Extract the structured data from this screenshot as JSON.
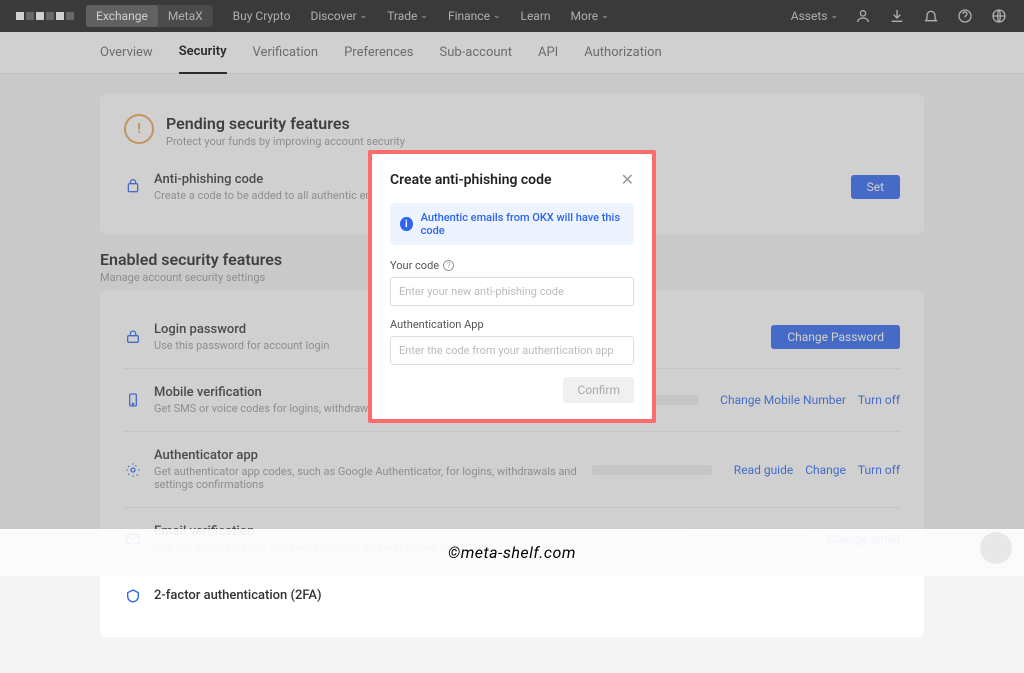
{
  "top": {
    "toggle": {
      "active": "Exchange",
      "other": "MetaX"
    },
    "nav": [
      "Buy Crypto",
      "Discover",
      "Trade",
      "Finance",
      "Learn",
      "More"
    ],
    "nav_has_chevron": [
      false,
      true,
      true,
      true,
      false,
      true
    ],
    "assets": "Assets"
  },
  "subtabs": [
    "Overview",
    "Security",
    "Verification",
    "Preferences",
    "Sub-account",
    "API",
    "Authorization"
  ],
  "active_subtab": "Security",
  "pending": {
    "title": "Pending security features",
    "subtitle": "Protect your funds by improving account security",
    "item": {
      "title": "Anti-phishing code",
      "desc": "Create a code to be added to all authentic emails from OKX",
      "action": "Set"
    }
  },
  "enabled": {
    "title": "Enabled security features",
    "subtitle": "Manage account security settings",
    "items": [
      {
        "title": "Login password",
        "desc": "Use this password for account login",
        "actions": [
          "Change Password"
        ],
        "primary": true
      },
      {
        "title": "Mobile verification",
        "desc": "Get SMS or voice codes for logins, withdrawals, password changes",
        "actions": [
          "Change Mobile Number",
          "Turn off"
        ]
      },
      {
        "title": "Authenticator app",
        "desc": "Get authenticator app codes, such as Google Authenticator, for logins, withdrawals and settings confirmations",
        "actions": [
          "Read guide",
          "Change",
          "Turn off"
        ]
      },
      {
        "title": "Email verification",
        "desc": "Use this email for login, password updates and withdrawal notifications",
        "actions": [
          "Change email"
        ]
      },
      {
        "title": "2-factor authentication (2FA)",
        "desc": "",
        "actions": []
      }
    ]
  },
  "modal": {
    "title": "Create anti-phishing code",
    "banner": "Authentic emails from OKX will have this code",
    "fields": {
      "code_label": "Your code",
      "code_placeholder": "Enter your new anti-phishing code",
      "auth_label": "Authentication App",
      "auth_placeholder": "Enter the code from your authentication app"
    },
    "confirm": "Confirm"
  },
  "watermark": "©meta-shelf.com"
}
